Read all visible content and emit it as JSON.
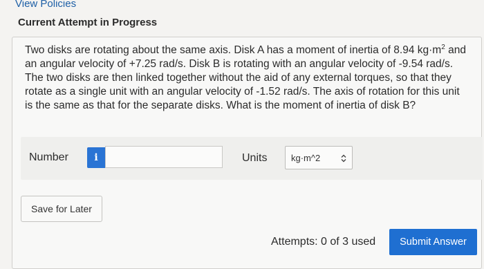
{
  "header": {
    "view_policies": "View Policies",
    "attempt_title": "Current Attempt in Progress"
  },
  "question": {
    "text_before_sup": "Two disks are rotating about the same axis. Disk A has a moment of inertia of 8.94 kg·m",
    "sup": "2",
    "text_after_sup": " and an angular velocity of +7.25 rad/s. Disk B is rotating with an angular velocity of -9.54 rad/s. The two disks are then linked together without the aid of any external torques, so that they rotate as a single unit with an angular velocity of -1.52 rad/s. The axis of rotation for this unit is the same as that for the separate disks. What is the moment of inertia of disk B?"
  },
  "answer": {
    "number_label": "Number",
    "info_glyph": "i",
    "number_value": "",
    "units_label": "Units",
    "units_selected": "kg·m^2"
  },
  "actions": {
    "save_label": "Save for Later",
    "attempts_text": "Attempts: 0 of 3 used",
    "submit_label": "Submit Answer"
  },
  "colors": {
    "accent": "#1f6fd1",
    "info_blue": "#2a74d4",
    "link": "#1d5fa6"
  },
  "icons": {
    "info": "info-icon",
    "select": "up-down-chevron-icon"
  }
}
